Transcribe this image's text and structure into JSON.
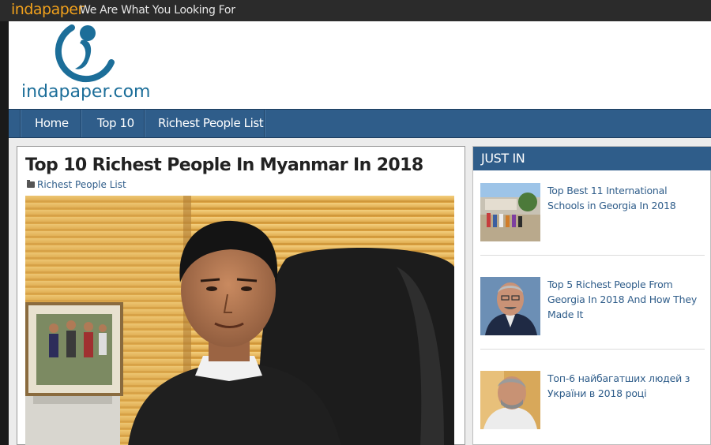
{
  "topbar": {
    "brand": "indapaper",
    "tagline": "We Are What You Looking For"
  },
  "header": {
    "logo_text": "indapaper.com"
  },
  "nav": {
    "items": [
      "Home",
      "Top 10",
      "Richest People List"
    ]
  },
  "article": {
    "title": "Top 10 Richest People In Myanmar In 2018",
    "category": "Richest People List"
  },
  "sidebar": {
    "heading": "JUST IN",
    "items": [
      {
        "title": "Top Best 11 International Schools in Georgia In 2018"
      },
      {
        "title": "Top 5 Richest People From Georgia In 2018 And How They Made It"
      },
      {
        "title": "Топ-6 найбагатших людей з України в 2018 році"
      }
    ]
  },
  "colors": {
    "nav": "#2f5d8a",
    "brand": "#f0a01c",
    "logo": "#1c6e99",
    "link": "#2f5d8a"
  }
}
